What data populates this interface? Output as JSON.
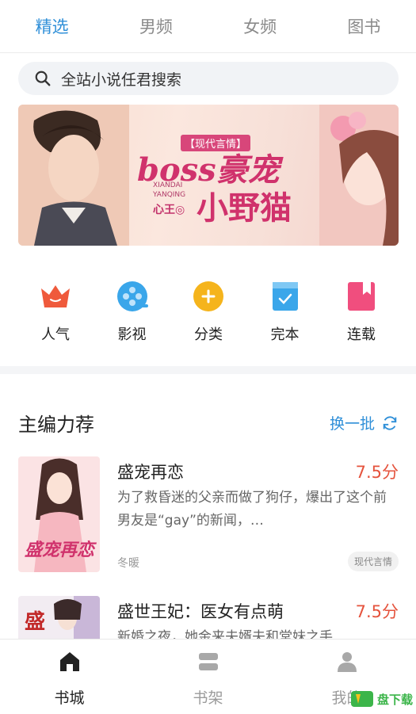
{
  "tabs": [
    {
      "label": "精选",
      "active": true
    },
    {
      "label": "男频",
      "active": false
    },
    {
      "label": "女频",
      "active": false
    },
    {
      "label": "图书",
      "active": false
    }
  ],
  "search": {
    "text": "全站小说任君搜索",
    "icon": "search-icon"
  },
  "banner": {
    "tag": "【现代言情】",
    "title_line1": "boss豪宠",
    "title_line2": "小野猫",
    "pinyin_1": "XIANDAI",
    "pinyin_2": "YANQING",
    "author": "心王◎"
  },
  "categories": [
    {
      "label": "人气",
      "icon": "crown-icon",
      "color": "#ef5a3c"
    },
    {
      "label": "影视",
      "icon": "film-reel-icon",
      "color": "#3aa6ea"
    },
    {
      "label": "分类",
      "icon": "plus-circle-icon",
      "color": "#f5b41c"
    },
    {
      "label": "完本",
      "icon": "check-book-icon",
      "color": "#3aa6ea"
    },
    {
      "label": "连载",
      "icon": "bookmark-icon",
      "color": "#f04e7e"
    }
  ],
  "section": {
    "title": "主编力荐",
    "refresh_label": "换一批",
    "refresh_icon": "refresh-icon"
  },
  "books": [
    {
      "title": "盛宠再恋",
      "score": "7.5分",
      "desc": "为了救昏迷的父亲而做了狗仔，爆出了这个前男友是“gay”的新闻，…",
      "author": "冬暖",
      "tag": "现代言情",
      "cover_text": "盛宠再恋"
    },
    {
      "title": "盛世王妃：医女有点萌",
      "score": "7.5分",
      "desc": "新婚之夜，她金来夫婿夫和堂妹之手",
      "cover_text": "盛"
    }
  ],
  "bottom_nav": [
    {
      "label": "书城",
      "icon": "home-icon",
      "active": true
    },
    {
      "label": "书架",
      "icon": "bookshelf-icon",
      "active": false
    },
    {
      "label": "我的",
      "icon": "user-icon",
      "active": false
    }
  ],
  "watermark": {
    "text": "盘下载"
  },
  "colors": {
    "accent": "#2f8fd8",
    "score": "#e5533d",
    "banner_text": "#d0326c"
  }
}
